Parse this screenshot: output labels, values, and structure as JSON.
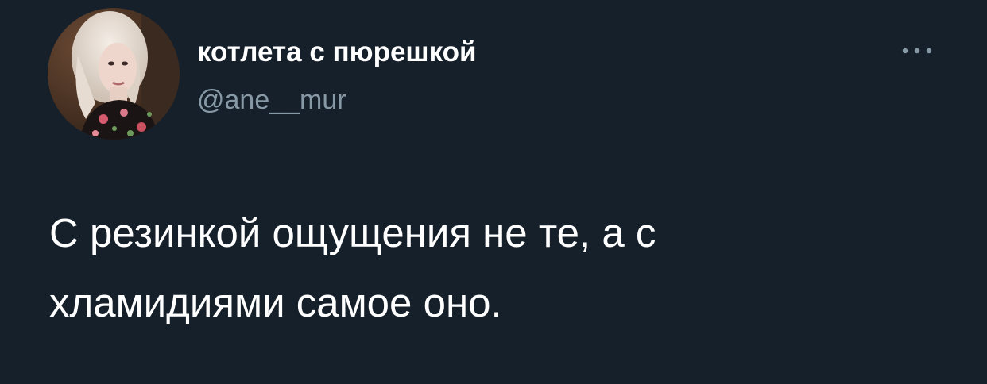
{
  "user": {
    "display_name": "котлета с пюрешкой",
    "handle": "@ane__mur",
    "avatar_icon": "user-avatar-photo"
  },
  "menu": {
    "icon": "more-horizontal-icon"
  },
  "tweet": {
    "text_lines": [
      "С резинкой ощущения не те, а с",
      "хламидиями самое оно."
    ]
  },
  "colors": {
    "background": "#15202b",
    "primary_text": "#ffffff",
    "secondary_text": "#8899a6"
  }
}
